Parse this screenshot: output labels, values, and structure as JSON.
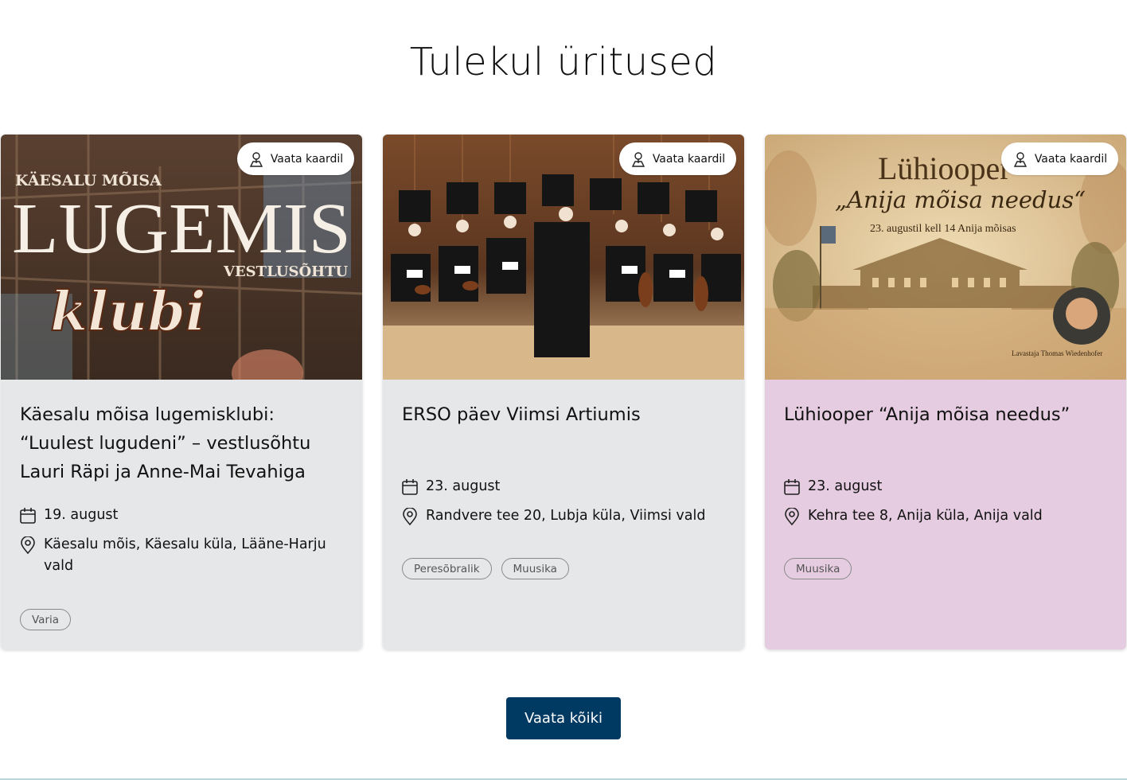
{
  "section": {
    "title": "Tulekul üritused"
  },
  "events": [
    {
      "map_label": "Vaata kaardil",
      "image_text": {
        "line1": "KÄESALU MÕISA",
        "line2": "LUGEMIS",
        "line3": "VESTLUSÕHTU",
        "line4": "klubi"
      },
      "title": "Käesalu mõisa lugemisklubi: “Luulest lugudeni” – vestlusõhtu Lauri Räpi ja Anne-Mai Tevahiga",
      "date": "19. august",
      "location": "Käesalu mõis, Käesalu küla, Lääne-Harju vald",
      "tags": [
        "Varia"
      ]
    },
    {
      "map_label": "Vaata kaardil",
      "title": "ERSO päev Viimsi Artiumis",
      "date": "23. august",
      "location": "Randvere tee 20, Lubja küla, Viimsi vald",
      "tags": [
        "Peresõbralik",
        "Muusika"
      ]
    },
    {
      "map_label": "Vaata kaardil",
      "image_text": {
        "line1": "Lühiooper",
        "line2": "„Anija mõisa needus“",
        "line3": "23. augustil kell 14 Anija mõisas",
        "line4": "Lavastaja Thomas Wiedenhofer"
      },
      "title": "Lühiooper “Anija mõisa needus”",
      "date": "23. august",
      "location": "Kehra tee 8, Anija küla, Anija vald",
      "tags": [
        "Muusika"
      ]
    }
  ],
  "footer": {
    "view_all_label": "Vaata kõiki"
  },
  "colors": {
    "card_bg": "#e6e7e9",
    "card_highlight_bg": "#e5cce0",
    "button_bg": "#003a63"
  }
}
